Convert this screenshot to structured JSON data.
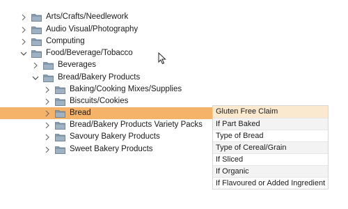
{
  "tree": {
    "items": [
      {
        "label": "Arts/Crafts/Needlework",
        "state": "collapsed"
      },
      {
        "label": "Audio Visual/Photography",
        "state": "collapsed"
      },
      {
        "label": "Computing",
        "state": "collapsed"
      },
      {
        "label": "Food/Beverage/Tobacco",
        "state": "expanded"
      },
      {
        "label": "Beverages",
        "state": "collapsed"
      },
      {
        "label": "Bread/Bakery Products",
        "state": "expanded"
      },
      {
        "label": "Baking/Cooking Mixes/Supplies",
        "state": "collapsed"
      },
      {
        "label": "Biscuits/Cookies",
        "state": "collapsed"
      },
      {
        "label": "Bread",
        "state": "collapsed",
        "selected": true
      },
      {
        "label": "Bread/Bakery Products Variety Packs",
        "state": "collapsed"
      },
      {
        "label": "Savoury Bakery Products",
        "state": "collapsed"
      },
      {
        "label": "Sweet Bakery Products",
        "state": "collapsed"
      }
    ]
  },
  "attributes": {
    "header": "Gluten Free Claim",
    "items": [
      "If Part Baked",
      "Type of Bread",
      "Type of Cereal/Grain",
      "If Sliced",
      "If Organic",
      "If Flavoured or Added Ingredient"
    ]
  },
  "colors": {
    "selection": "#f5b36a",
    "folder": "#8a9fb3",
    "header_bg": "#fbe9cf"
  },
  "icons": {
    "expand": "chevron-right-icon",
    "collapse": "chevron-down-icon",
    "folder": "folder-icon",
    "cursor": "mouse-pointer-icon"
  }
}
